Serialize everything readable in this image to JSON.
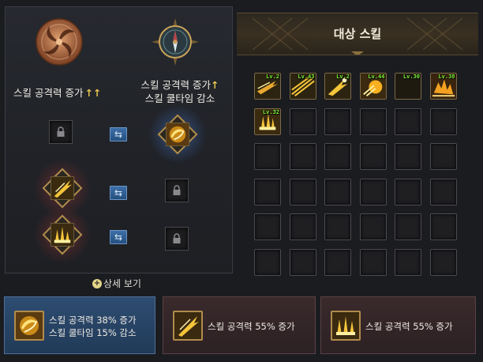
{
  "left": {
    "option_a": {
      "label": "스킬 공격력 증가",
      "arrows": "↑↑"
    },
    "option_b": {
      "label_line1": "스킬 공격력 증가",
      "arrow": "↑",
      "label_line2": "스킬 쿨타임 감소"
    },
    "swap_icon": "⇆",
    "detail_link": "상세 보기",
    "rows": [
      {
        "left_slot": "locked",
        "right_slot": "skill-wind-orb"
      },
      {
        "left_slot": "skill-slash",
        "right_slot": "locked"
      },
      {
        "left_slot": "skill-rising",
        "right_slot": "locked"
      }
    ]
  },
  "right": {
    "title": "대상 스킬",
    "skills": [
      {
        "level": "Lv.2",
        "icon": "skill-dash"
      },
      {
        "level": "Lv.43",
        "icon": "skill-streak"
      },
      {
        "level": "Lv.2",
        "icon": "skill-strike"
      },
      {
        "level": "Lv.44",
        "icon": "skill-burst"
      },
      {
        "level": "Lv.30",
        "icon": "skill-crescent"
      },
      {
        "level": "Lv.38",
        "icon": "skill-storm"
      },
      {
        "level": "Lv.32",
        "icon": "skill-summon"
      }
    ],
    "total_slots": 36
  },
  "cards": [
    {
      "line1": "스킬 공격력 38% 증가",
      "line2": "스킬 쿨타임 15% 감소",
      "icon": "skill-wind-orb",
      "selected": true
    },
    {
      "line1": "스킬 공격력 55% 증가",
      "line2": "",
      "icon": "skill-slash",
      "selected": false
    },
    {
      "line1": "스킬 공격력 55% 증가",
      "line2": "",
      "icon": "skill-rising",
      "selected": false
    }
  ],
  "colors": {
    "gold": "#e8c850",
    "level_green": "#7cf43a",
    "selected_card": "#2e4d72"
  }
}
